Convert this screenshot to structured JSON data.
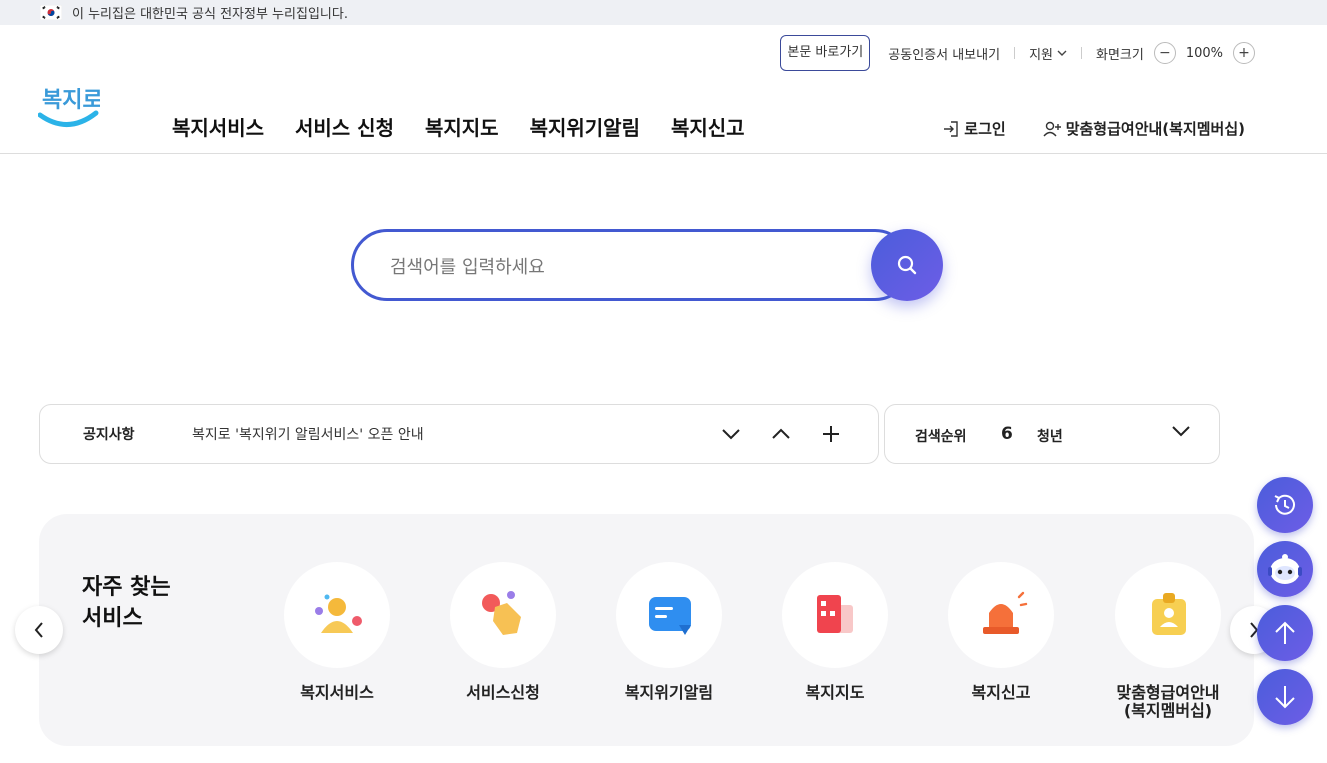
{
  "gov_banner": {
    "text": "이 누리집은 대한민국 공식 전자정부 누리집입니다."
  },
  "utility": {
    "skip_label": "본문 바로가기",
    "cert_label": "공동인증서 내보내기",
    "support_label": "지원",
    "zoom_label": "화면크기",
    "zoom_value": "100%",
    "zoom_out": "−",
    "zoom_in": "+"
  },
  "logo": {
    "text": "복지로"
  },
  "nav": {
    "items": [
      "복지서비스",
      "서비스 신청",
      "복지지도",
      "복지위기알림",
      "복지신고"
    ]
  },
  "user_links": {
    "login": "로그인",
    "membership": "맞춤형급여안내(복지멤버십)"
  },
  "search": {
    "placeholder": "검색어를 입력하세요"
  },
  "notice": {
    "label": "공지사항",
    "text": "복지로 '복지위기 알림서비스' 오픈 안내"
  },
  "ranking": {
    "label": "검색순위",
    "number": "6",
    "keyword": "청년"
  },
  "favorites": {
    "title_line1": "자주 찾는",
    "title_line2": "서비스",
    "items": [
      {
        "label": "복지서비스",
        "icon": "people-icon"
      },
      {
        "label": "서비스신청",
        "icon": "hand-pointer-icon"
      },
      {
        "label": "복지위기알림",
        "icon": "message-icon"
      },
      {
        "label": "복지지도",
        "icon": "map-building-icon"
      },
      {
        "label": "복지신고",
        "icon": "siren-icon"
      },
      {
        "label": "맞춤형급여안내",
        "label2": "(복지멤버십)",
        "icon": "id-badge-icon"
      }
    ]
  },
  "colors": {
    "accent": "#4b5ddb",
    "accent2": "#6d5de6",
    "border": "#dddddd",
    "panel": "#f5f5f7"
  }
}
